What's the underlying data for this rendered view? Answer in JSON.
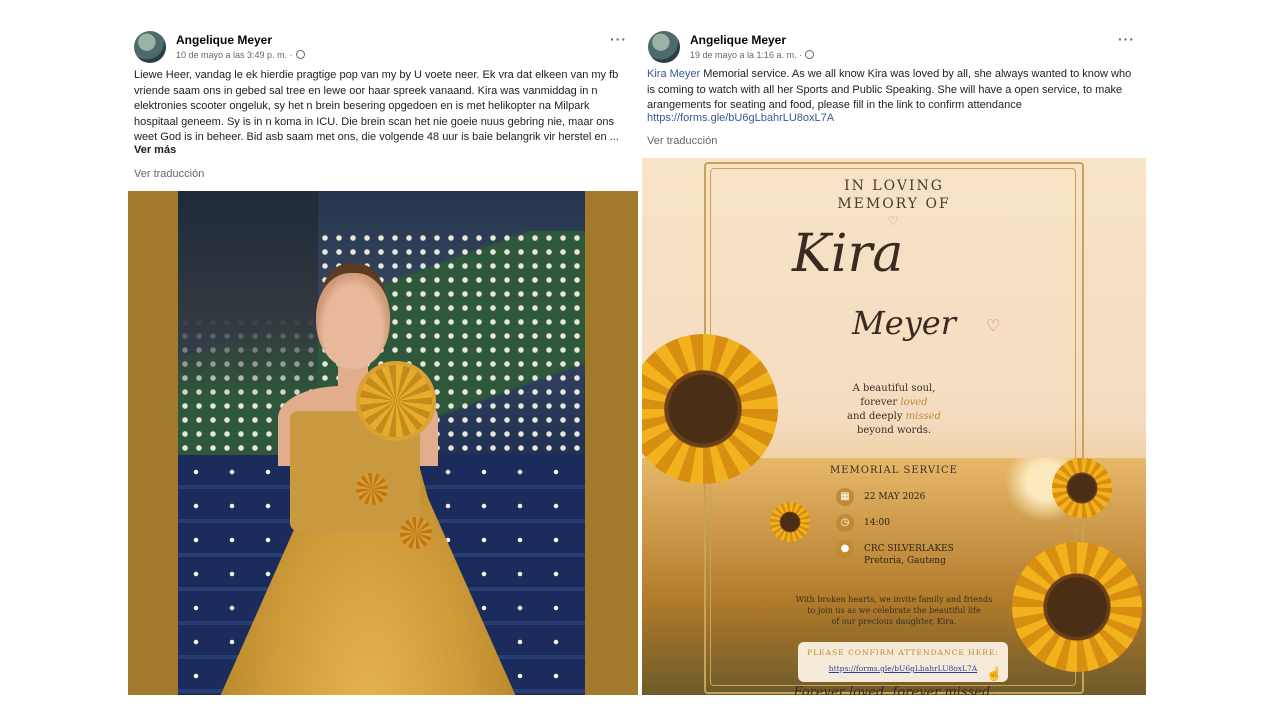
{
  "left_post": {
    "author": "Angelique Meyer",
    "timestamp": "10 de mayo a las 3:49 p. m. ·",
    "more_icon": "···",
    "text": "Liewe Heer, vandag le ek hierdie pragtige pop van my by U voete neer. Ek vra dat elkeen van my fb vriende saam ons in gebed sal tree en lewe oor haar spreek vanaand. Kira was vanmiddag in n elektronies scooter ongeluk, sy het n brein besering opgedoen en is met helikopter na Milpark hospitaal geneem. Sy is in n koma in ICU. Die brein scan het nie goeie nuus gebring nie, maar ons weet God is in beheer. Bid asb saam met ons, die volgende 48 uur is baie belangrik vir herstel en ...",
    "see_more": "Ver más",
    "translate": "Ver traducción"
  },
  "right_post": {
    "author": "Angelique Meyer",
    "timestamp": "19 de mayo a la 1:16 a. m. ·",
    "more_icon": "···",
    "mention": "Kira Meyer",
    "text": " Memorial service. As we all know Kira was loved by all, she always wanted to know who is coming to watch with all her Sports and Public Speaking. She will have a open service, to make arangements for seating and food, please fill in the link to confirm attendance",
    "link": "https://forms.gle/bU6gLbahrLU8oxL7A",
    "translate": "Ver traducción"
  },
  "poster": {
    "heading_line1": "IN LOVING",
    "heading_line2": "MEMORY OF",
    "first_name": "Kira",
    "last_name": "Meyer",
    "tribute_1": "A beautiful soul,",
    "tribute_2a": "forever ",
    "tribute_2b": "loved",
    "tribute_3a": "and deeply ",
    "tribute_3b": "missed",
    "tribute_4": "beyond words.",
    "service_title": "MEMORIAL SERVICE",
    "date": "22 MAY 2026",
    "time": "14:00",
    "venue": "CRC SILVERLAKES",
    "venue_city": "Pretoria, Gauteng",
    "invite_1": "With broken hearts, we invite family and friends",
    "invite_2": "to join us as we celebrate the beautiful life",
    "invite_3": "of our precious daughter, Kira.",
    "confirm_label": "PLEASE CONFIRM ATTENDANCE HERE:",
    "confirm_link": "https://forms.gle/bU6gLbahrLU8oxL7A",
    "footer": "Forever loved, forever missed."
  },
  "icons": {
    "calendar": "calendar-icon",
    "clock": "clock-icon",
    "location": "location-pin-icon"
  },
  "colors": {
    "facebook_link": "#385898",
    "gold_accent": "#c08a35",
    "photo_frame": "#a27a2c"
  }
}
